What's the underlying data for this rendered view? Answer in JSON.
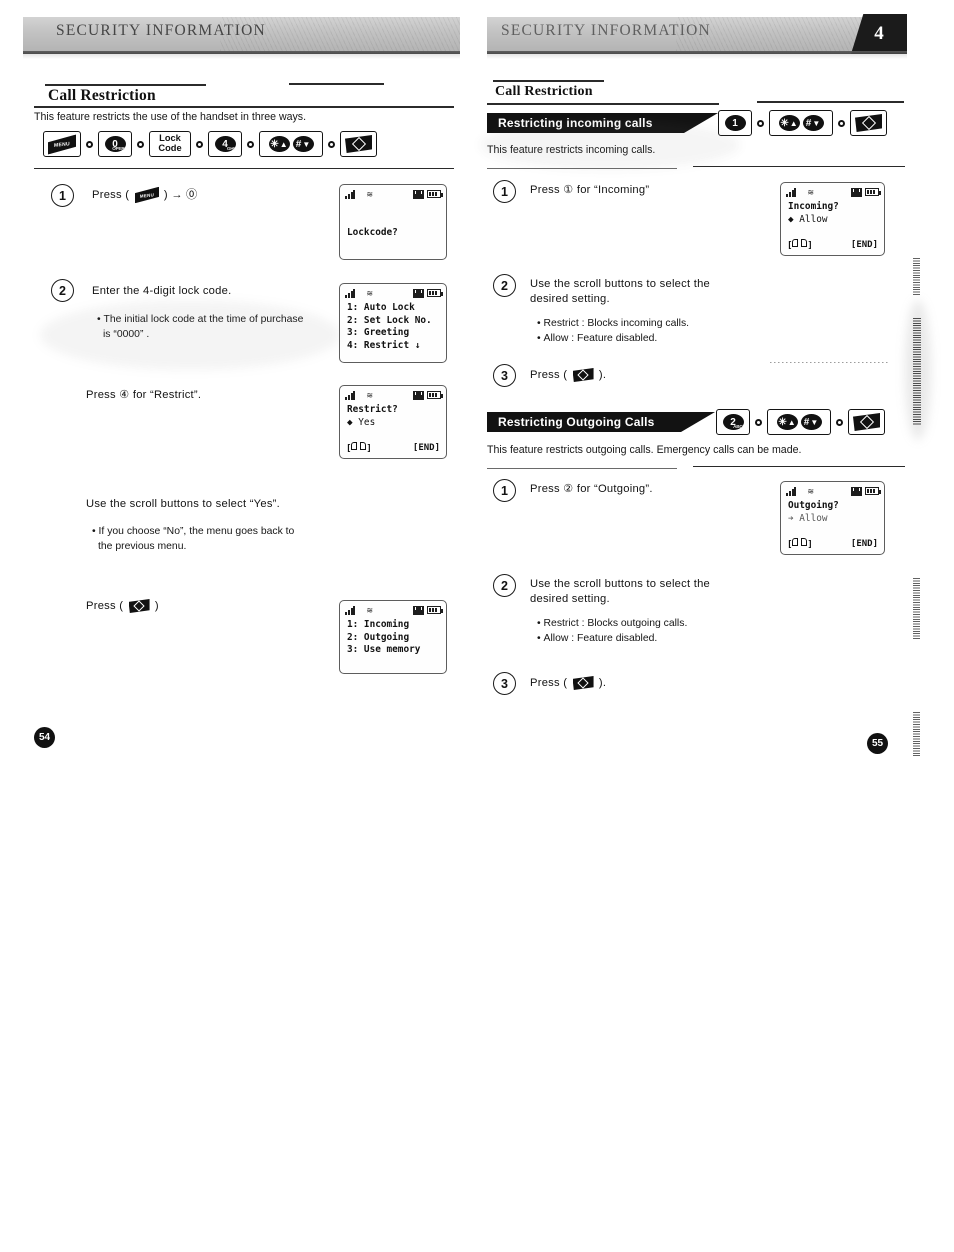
{
  "document": {
    "type": "phone-user-manual-spread",
    "header_title": "SECURITY INFORMATION",
    "chapter_tab": "4"
  },
  "left_page": {
    "page_number": "54",
    "header_title": "SECURITY INFORMATION",
    "section_title": "Call Restriction",
    "intro": "This feature restricts the use of the handset in three ways.",
    "key_sequence": [
      {
        "type": "menu-key",
        "label": "MENU"
      },
      {
        "type": "numeric-key",
        "digit": "0",
        "sub": "OPER"
      },
      {
        "type": "text-key",
        "line1": "Lock",
        "line2": "Code"
      },
      {
        "type": "numeric-key",
        "digit": "4",
        "sub": "GHI"
      },
      {
        "type": "scroll-keys",
        "keys": [
          {
            "digit": "✱",
            "arrow": "▲"
          },
          {
            "digit": "#",
            "arrow": "▼"
          }
        ]
      },
      {
        "type": "ok-key",
        "label": "OK"
      }
    ],
    "steps": [
      {
        "number": "1",
        "text_before": "Press (",
        "key": "menu-key",
        "text_after": ") → ⓪",
        "bullets": []
      },
      {
        "number": "2",
        "text": "Enter the 4-digit lock code.",
        "bullets": [
          "The initial lock code at the time of purchase",
          "is “0000” ."
        ]
      },
      {
        "number": "",
        "text": "Press ④ for “Restrict”.",
        "bullets": []
      },
      {
        "number": "",
        "text": "Use the scroll buttons to select “Yes”.",
        "bullets": [
          "If you choose “No”, the menu goes back to",
          "the previous menu."
        ]
      },
      {
        "number": "",
        "text_before": "Press (",
        "key": "ok-key",
        "text_after": ")",
        "bullets": []
      }
    ],
    "screens": [
      {
        "name": "lockcode-screen",
        "lines": [
          "",
          "",
          "Lockcode?"
        ],
        "softkeys": {
          "left": "",
          "right": ""
        }
      },
      {
        "name": "security-menu-screen",
        "lines": [
          "1: Auto Lock",
          "2: Set Lock No.",
          "3: Greeting",
          "4: Restrict      ↓"
        ],
        "softkeys": {
          "left": "",
          "right": ""
        }
      },
      {
        "name": "restrict-confirm-screen",
        "lines": [
          "Restrict?",
          "◆ Yes"
        ],
        "softkeys": {
          "left": "book-icon",
          "right": "[END]"
        }
      },
      {
        "name": "restrict-menu-screen",
        "lines": [
          "1: Incoming",
          "2: Outgoing",
          "3: Use memory"
        ],
        "softkeys": {
          "left": "",
          "right": ""
        }
      }
    ]
  },
  "right_page": {
    "page_number": "55",
    "header_title": "SECURITY INFORMATION",
    "chapter_tab": "4",
    "section_title": "Call Restriction",
    "subsections": [
      {
        "banner": "Restricting incoming calls",
        "key_sequence": [
          {
            "type": "numeric-key",
            "digit": "1",
            "sub": ""
          },
          {
            "type": "scroll-keys",
            "keys": [
              {
                "digit": "✱",
                "arrow": "▲"
              },
              {
                "digit": "#",
                "arrow": "▼"
              }
            ]
          },
          {
            "type": "ok-key",
            "label": "OK"
          }
        ],
        "intro": "This feature restricts incoming calls.",
        "steps": [
          {
            "number": "1",
            "text": "Press ① for “Incoming”",
            "bullets": []
          },
          {
            "number": "2",
            "text": "Use the scroll buttons to select the\ndesired setting.",
            "bullets": [
              "Restrict : Blocks incoming calls.",
              "Allow : Feature disabled."
            ]
          },
          {
            "number": "3",
            "text_before": "Press (",
            "key": "ok-key",
            "text_after": ").",
            "bullets": []
          }
        ],
        "screen": {
          "name": "incoming-setting-screen",
          "lines": [
            "Incoming?",
            "◆ Allow"
          ],
          "softkeys": {
            "left": "book-icon",
            "right": "[END]"
          }
        }
      },
      {
        "banner": "Restricting Outgoing Calls",
        "key_sequence": [
          {
            "type": "numeric-key",
            "digit": "2",
            "sub": "ABC"
          },
          {
            "type": "scroll-keys",
            "keys": [
              {
                "digit": "✱",
                "arrow": "▲"
              },
              {
                "digit": "#",
                "arrow": "▼"
              }
            ]
          },
          {
            "type": "ok-key",
            "label": "OK"
          }
        ],
        "intro": "This feature restricts outgoing calls. Emergency calls can be made.",
        "steps": [
          {
            "number": "1",
            "text": "Press ② for “Outgoing”.",
            "bullets": []
          },
          {
            "number": "2",
            "text": "Use the scroll buttons to select the\ndesired setting.",
            "bullets": [
              "Restrict : Blocks outgoing calls.",
              "Allow : Feature disabled."
            ]
          },
          {
            "number": "3",
            "text_before": "Press (",
            "key": "ok-key",
            "text_after": ").",
            "bullets": []
          }
        ],
        "screen": {
          "name": "outgoing-setting-screen",
          "lines": [
            "Outgoing?",
            "➔ Allow"
          ],
          "softkeys": {
            "left": "book-icon",
            "right": "[END]"
          }
        }
      }
    ]
  },
  "colors": {
    "ink": "#121212",
    "header_band": "#c2c2c2",
    "banner": "#121212",
    "paper": "#ffffff"
  }
}
